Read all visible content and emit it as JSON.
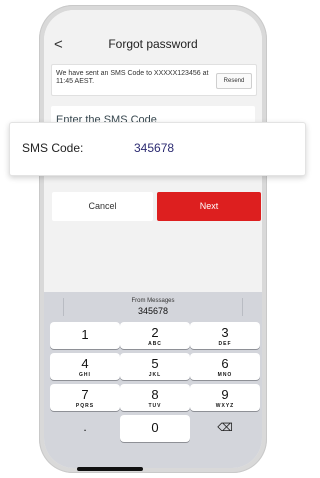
{
  "nav": {
    "title": "Forgot password",
    "back_glyph": "<"
  },
  "notice": {
    "message": "We have sent an SMS Code to XXXXX123456 at 11:45 AEST.",
    "resend_label": "Resend"
  },
  "code_card": {
    "title": "Enter the SMS Code"
  },
  "overlay": {
    "label": "SMS Code:",
    "value": "345678"
  },
  "buttons": {
    "cancel": "Cancel",
    "next": "Next"
  },
  "keyboard": {
    "suggestion_source": "From Messages",
    "suggestion_code": "345678",
    "keys": [
      {
        "num": "1",
        "sub": ""
      },
      {
        "num": "2",
        "sub": "ABC"
      },
      {
        "num": "3",
        "sub": "DEF"
      },
      {
        "num": "4",
        "sub": "GHI"
      },
      {
        "num": "5",
        "sub": "JKL"
      },
      {
        "num": "6",
        "sub": "MNO"
      },
      {
        "num": "7",
        "sub": "PQRS"
      },
      {
        "num": "8",
        "sub": "TUV"
      },
      {
        "num": "9",
        "sub": "WXYZ"
      }
    ],
    "dot_label": ".",
    "zero": "0",
    "delete_glyph": "⌫"
  },
  "colors": {
    "accent": "#dd1f1f",
    "code_text": "#2c2b72"
  }
}
